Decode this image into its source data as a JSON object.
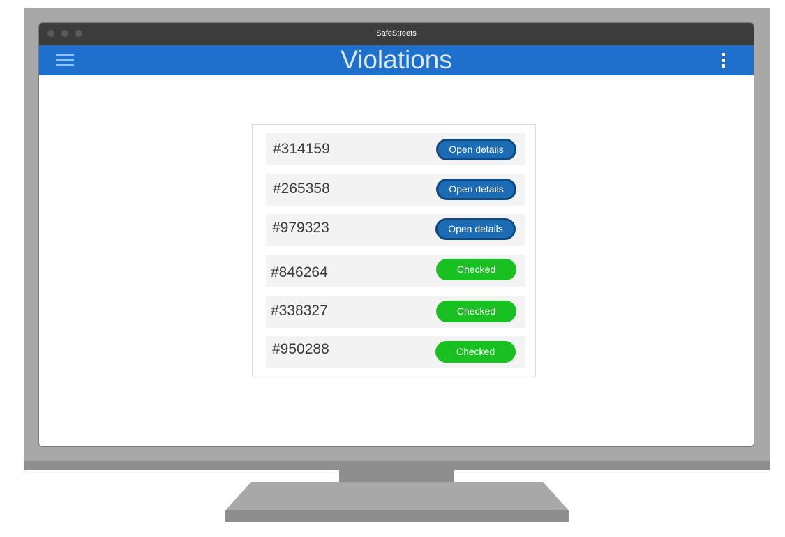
{
  "window": {
    "title": "SafeStreets"
  },
  "appbar": {
    "title": "Violations",
    "menu_icon": "hamburger-menu-icon",
    "more_icon": "more-vertical-icon"
  },
  "violations": [
    {
      "id": "#314159",
      "action": "Open details",
      "status": "open"
    },
    {
      "id": "#265358",
      "action": "Open details",
      "status": "open"
    },
    {
      "id": "#979323",
      "action": "Open details",
      "status": "open"
    },
    {
      "id": "#846264",
      "action": "Checked",
      "status": "checked"
    },
    {
      "id": "#338327",
      "action": "Checked",
      "status": "checked"
    },
    {
      "id": "#950288",
      "action": "Checked",
      "status": "checked"
    }
  ],
  "colors": {
    "appbar": "#1f70cc",
    "open_button": "#1b6bb5",
    "checked_button": "#18c021"
  }
}
